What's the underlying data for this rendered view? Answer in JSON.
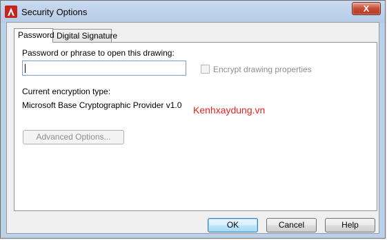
{
  "window": {
    "title": "Security Options",
    "close_glyph": "X",
    "app_icon": "autocad-a-icon"
  },
  "tabs": [
    {
      "label": "Password",
      "active": true
    },
    {
      "label": "Digital Signature",
      "active": false
    }
  ],
  "password_tab": {
    "prompt_label": "Password or phrase to open this drawing:",
    "password_value": "",
    "encrypt_checkbox": {
      "label": "Encrypt drawing properties",
      "checked": false,
      "enabled": false
    },
    "encryption_type_label": "Current encryption type:",
    "encryption_type_value": "Microsoft Base Cryptographic Provider v1.0",
    "advanced_button": "Advanced Options..."
  },
  "watermark": "Kenhxaydung.vn",
  "buttons": {
    "ok": "OK",
    "cancel": "Cancel",
    "help": "Help"
  },
  "colors": {
    "watermark": "#e8221b",
    "disabled_text": "#8d8d8d",
    "titlebar": "#bcd0e8",
    "close_button": "#c44a33"
  }
}
